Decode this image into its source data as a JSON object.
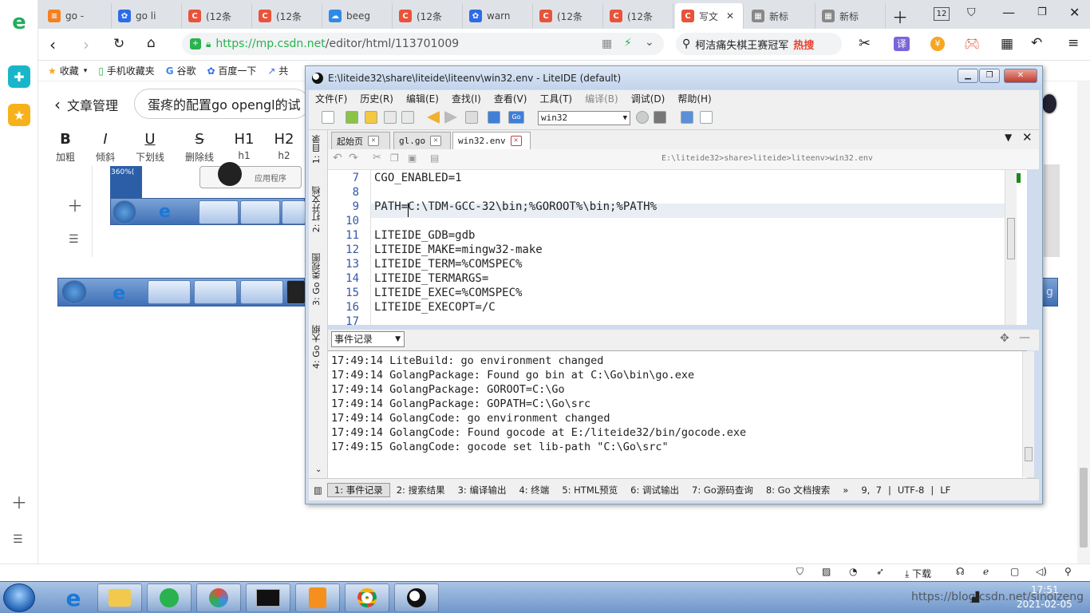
{
  "browser": {
    "tabs": [
      {
        "label": "go -",
        "icon": "stack-icon",
        "color": "#f48024"
      },
      {
        "label": "go li",
        "icon": "paw-icon",
        "color": "#2e6be6"
      },
      {
        "label": "(12条",
        "icon": "csdn-icon",
        "color": "#e8533a"
      },
      {
        "label": "(12条",
        "icon": "csdn-icon",
        "color": "#e8533a"
      },
      {
        "label": "beeg",
        "icon": "cloud-icon",
        "color": "#2e8ae6"
      },
      {
        "label": "(12条",
        "icon": "csdn-icon",
        "color": "#e8533a"
      },
      {
        "label": "warn",
        "icon": "paw-icon",
        "color": "#2e6be6"
      },
      {
        "label": "(12条",
        "icon": "csdn-icon",
        "color": "#e8533a"
      },
      {
        "label": "(12条",
        "icon": "csdn-icon",
        "color": "#e8533a"
      },
      {
        "label": "写文",
        "icon": "csdn-icon",
        "color": "#e8533a",
        "active": true
      },
      {
        "label": "新标",
        "icon": "grid-icon",
        "color": "#555"
      },
      {
        "label": "新标",
        "icon": "grid-icon",
        "color": "#555"
      }
    ],
    "tab_count": "12",
    "url_https": "https://",
    "url_host": "mp.csdn.net",
    "url_path": "/editor/html/113701009",
    "search_text": "柯洁痛失棋王赛冠军",
    "hot_label": "热搜",
    "bookmarks": [
      "收藏",
      "手机收藏夹",
      "谷歌",
      "百度一下",
      "共"
    ]
  },
  "page": {
    "back_label": "文章管理",
    "title_input": "蛋疼的配置go opengl的试",
    "format": [
      {
        "glyph": "B",
        "label": "加粗"
      },
      {
        "glyph": "I",
        "label": "倾斜"
      },
      {
        "glyph": "U",
        "label": "下划线"
      },
      {
        "glyph": "S",
        "label": "删除线"
      },
      {
        "glyph": "H1",
        "label": "h1"
      },
      {
        "glyph": "H2",
        "label": "h2"
      }
    ],
    "thumb_label": "应用程序",
    "thumb_counter": "360%(",
    "strip_right_text": "g"
  },
  "liteide": {
    "title": "E:\\liteide32\\share\\liteide\\liteenv\\win32.env - LiteIDE (default)",
    "menus": [
      "文件(F)",
      "历史(R)",
      "编辑(E)",
      "查找(I)",
      "查看(V)",
      "工具(T)",
      "编译(B)",
      "调试(D)",
      "帮助(H)"
    ],
    "env_combo": "win32",
    "left_dock": [
      "1: 目录",
      "2: 打开文档",
      "3: Go 类视图",
      "4: Go 大纲"
    ],
    "editor_tabs": [
      "起始页",
      "gl.go",
      "win32.env"
    ],
    "breadcrumb": "E:\\liteide32>share>liteide>liteenv>win32.env",
    "lines": [
      {
        "n": "7",
        "text": "CGO_ENABLED=1"
      },
      {
        "n": "8",
        "text": ""
      },
      {
        "n": "9",
        "text": "PATH=C:\\TDM-GCC-32\\bin;%GOROOT%\\bin;%PATH%"
      },
      {
        "n": "10",
        "text": ""
      },
      {
        "n": "11",
        "text": "LITEIDE_GDB=gdb"
      },
      {
        "n": "12",
        "text": "LITEIDE_MAKE=mingw32-make"
      },
      {
        "n": "13",
        "text": "LITEIDE_TERM=%COMSPEC%"
      },
      {
        "n": "14",
        "text": "LITEIDE_TERMARGS="
      },
      {
        "n": "15",
        "text": "LITEIDE_EXEC=%COMSPEC%"
      },
      {
        "n": "16",
        "text": "LITEIDE_EXECOPT=/C"
      },
      {
        "n": "17",
        "text": ""
      }
    ],
    "log_combo": "事件记录",
    "log": [
      "17:49:14 LiteBuild: go environment changed",
      "17:49:14 GolangPackage: Found go bin at C:\\Go\\bin\\go.exe",
      "17:49:14 GolangPackage: GOROOT=C:\\Go",
      "17:49:14 GolangPackage: GOPATH=C:\\Go\\src",
      "17:49:14 GolangCode: go environment changed",
      "17:49:14 GolangCode: Found gocode at E:/liteide32/bin/gocode.exe",
      "17:49:15 GolangCode: gocode set lib-path \"C:\\Go\\src\""
    ],
    "status_tabs": [
      "1: 事件记录",
      "2: 搜索结果",
      "3: 编译输出",
      "4: 终端",
      "5: HTML预览",
      "6: 调试输出",
      "7: Go源码查询",
      "8: Go 文档搜索"
    ],
    "more": "»",
    "position": "9,  7",
    "encoding": "UTF-8",
    "eol": "LF"
  },
  "browser_status": {
    "download": "下载"
  },
  "taskbar": {
    "time": "17:51",
    "date": "2021-02-05",
    "watermark": "https://blog.csdn.net/sinolzeng"
  }
}
